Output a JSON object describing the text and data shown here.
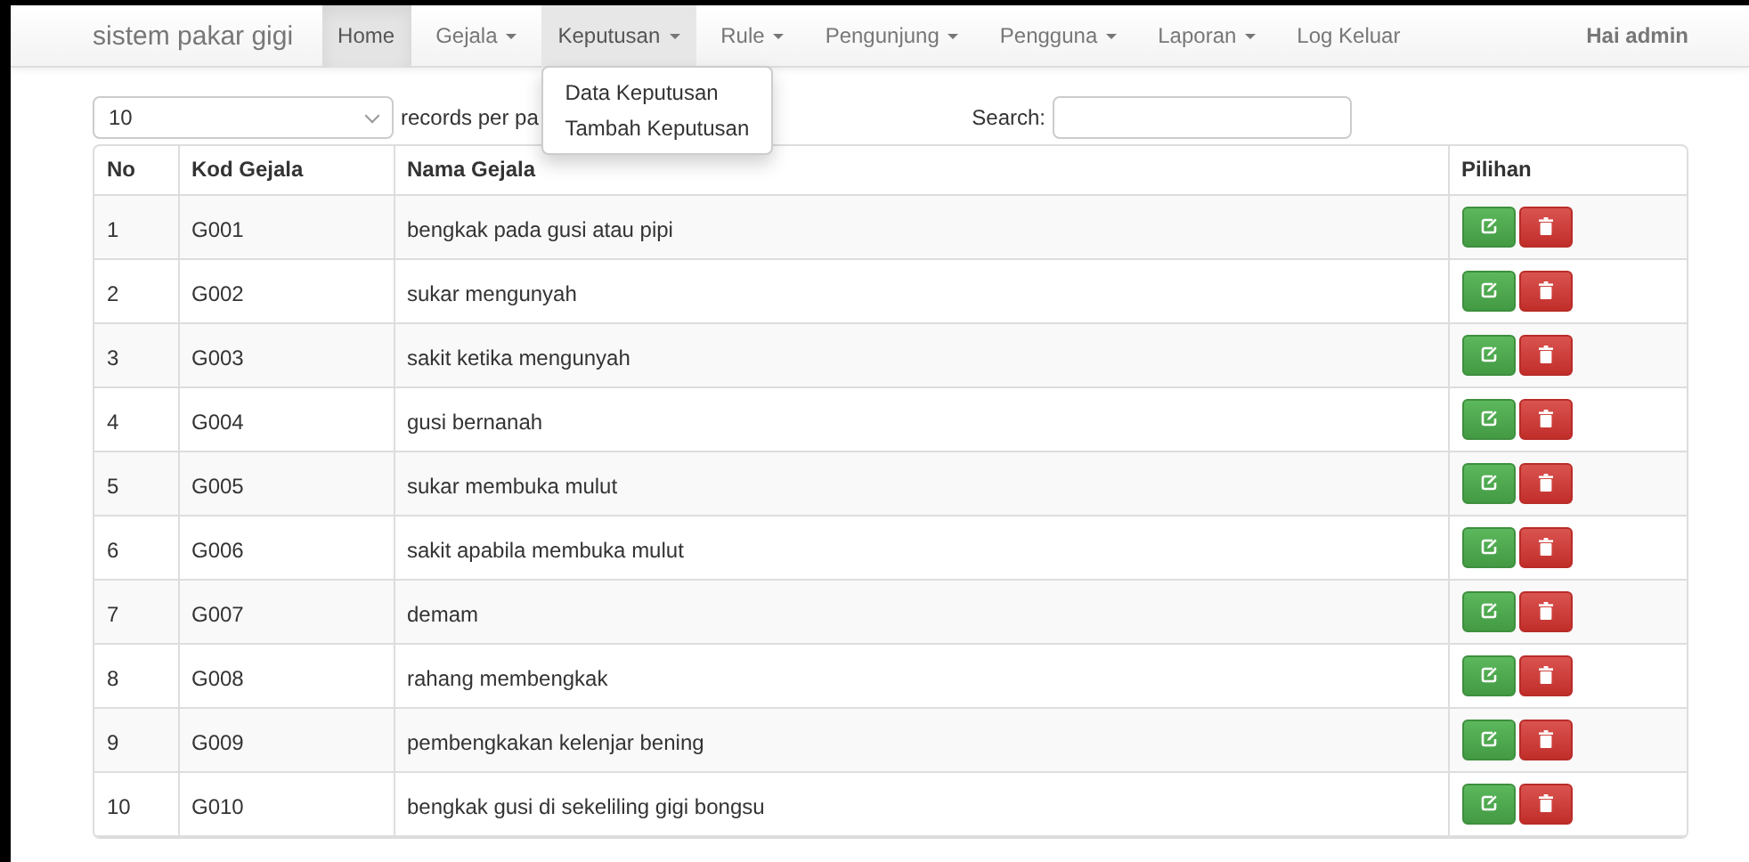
{
  "navbar": {
    "brand": "sistem pakar gigi",
    "items": [
      {
        "label": "Home",
        "kind": "link",
        "selected": true,
        "expanded": false
      },
      {
        "label": "Gejala",
        "kind": "dropdown",
        "selected": false,
        "expanded": false
      },
      {
        "label": "Keputusan",
        "kind": "dropdown",
        "selected": false,
        "expanded": true,
        "menu": [
          "Data Keputusan",
          "Tambah Keputusan"
        ]
      },
      {
        "label": "Rule",
        "kind": "dropdown",
        "selected": false,
        "expanded": false
      },
      {
        "label": "Pengunjung",
        "kind": "dropdown",
        "selected": false,
        "expanded": false
      },
      {
        "label": "Pengguna",
        "kind": "dropdown",
        "selected": false,
        "expanded": false
      },
      {
        "label": "Laporan",
        "kind": "dropdown",
        "selected": false,
        "expanded": false
      },
      {
        "label": "Log Keluar",
        "kind": "link",
        "selected": false,
        "expanded": false
      }
    ],
    "greeting": "Hai admin"
  },
  "page_length": {
    "value": "10",
    "label": "records per pa"
  },
  "search": {
    "label": "Search:"
  },
  "table": {
    "columns": [
      "No",
      "Kod Gejala",
      "Nama Gejala",
      "Pilihan"
    ],
    "rows": [
      [
        "1",
        "G001",
        "bengkak pada gusi atau pipi"
      ],
      [
        "2",
        "G002",
        "sukar mengunyah"
      ],
      [
        "3",
        "G003",
        "sakit ketika mengunyah"
      ],
      [
        "4",
        "G004",
        "gusi bernanah"
      ],
      [
        "5",
        "G005",
        "sukar membuka mulut"
      ],
      [
        "6",
        "G006",
        "sakit apabila membuka mulut"
      ],
      [
        "7",
        "G007",
        "demam"
      ],
      [
        "8",
        "G008",
        "rahang membengkak"
      ],
      [
        "9",
        "G009",
        "pembengkakan kelenjar bening"
      ],
      [
        "10",
        "G010",
        "bengkak gusi di sekeliling gigi bongsu"
      ]
    ]
  }
}
